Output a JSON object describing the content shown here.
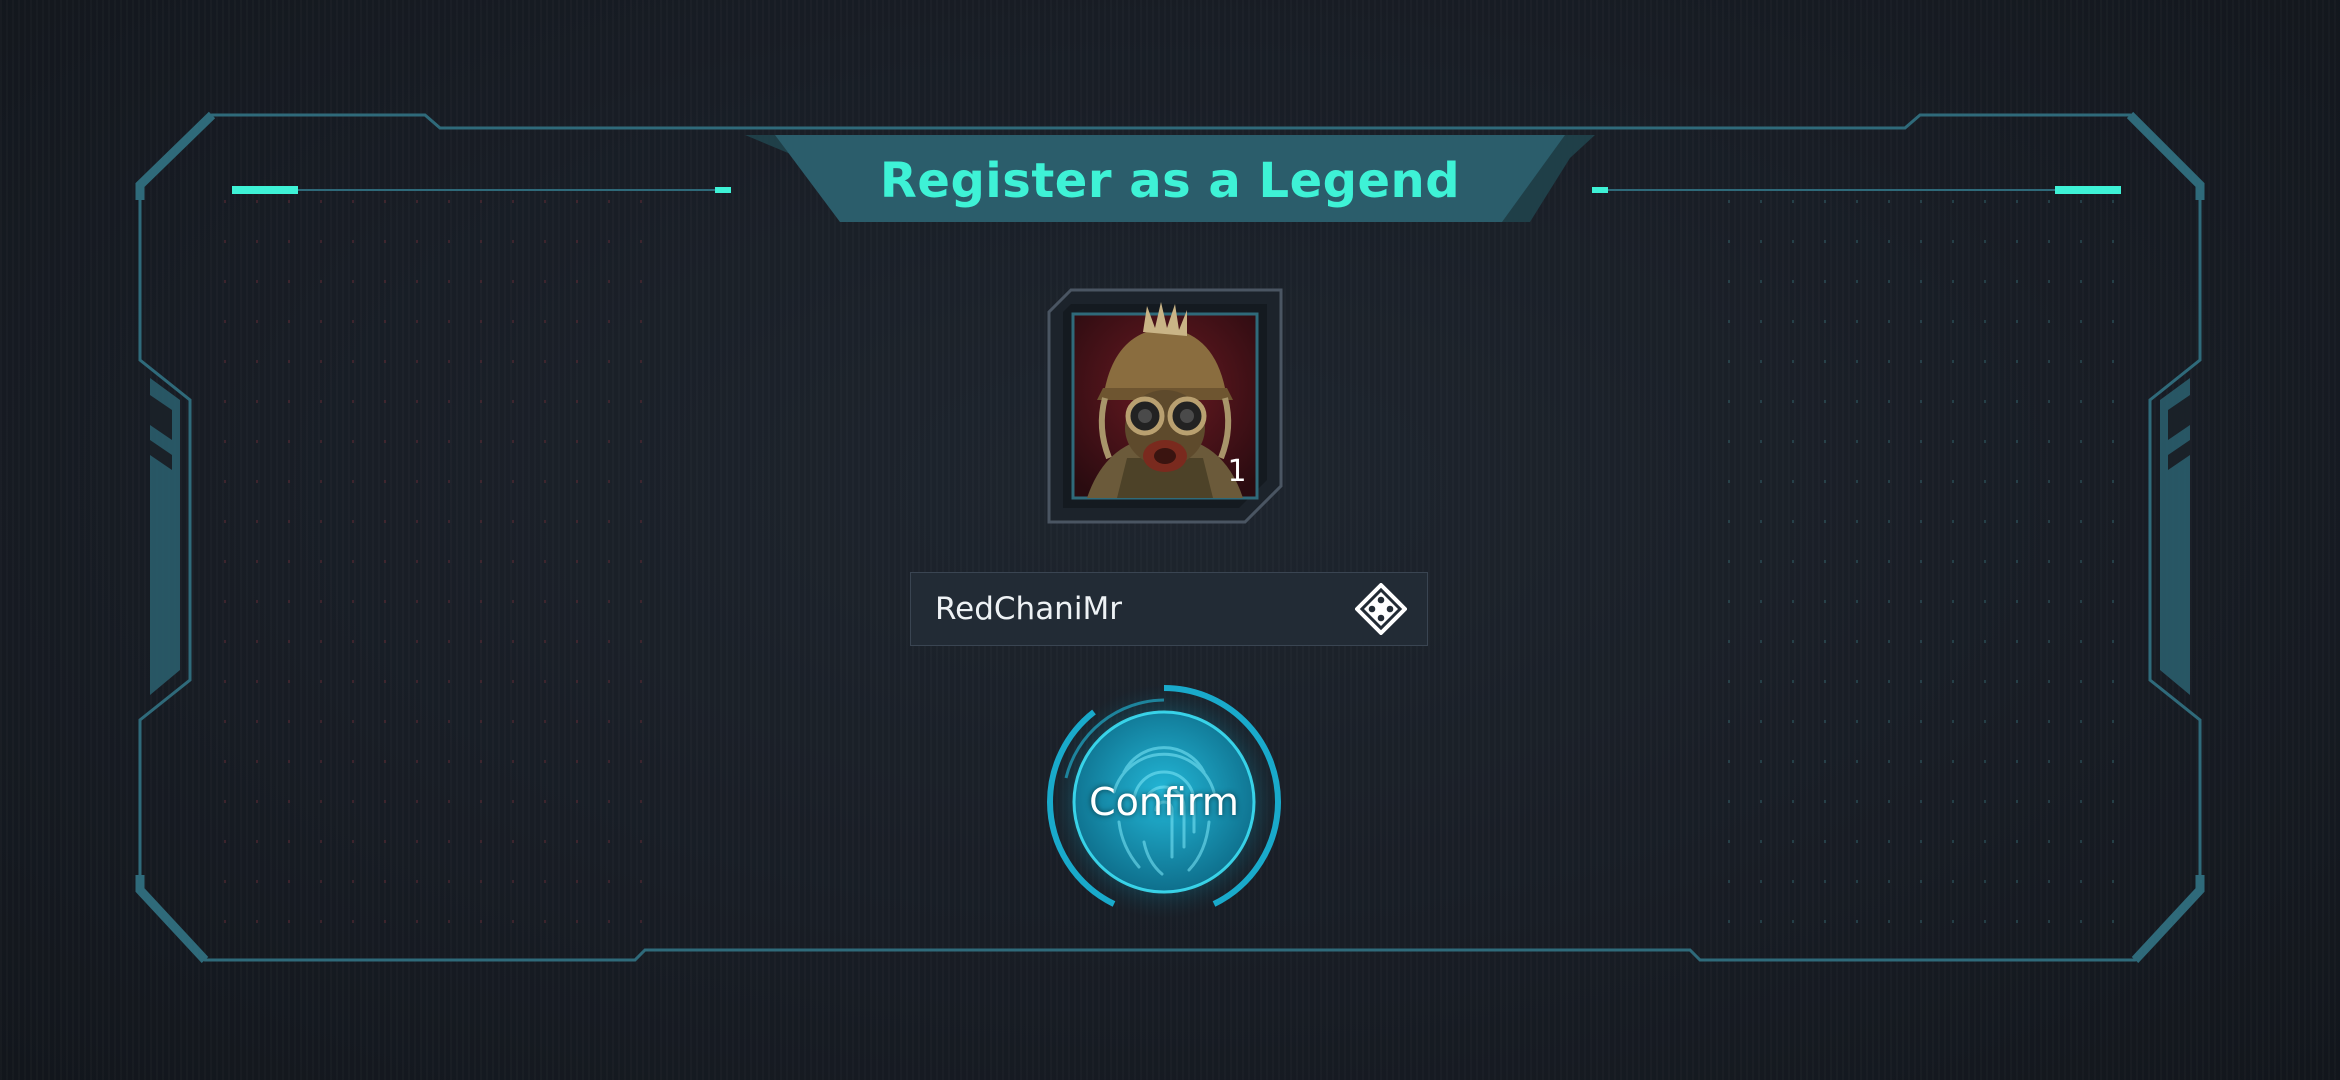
{
  "dialog": {
    "title": "Register as a Legend"
  },
  "avatar": {
    "character_icon": "legend-portrait-icon",
    "level_badge": "1"
  },
  "name_input": {
    "value": "RedChaniMr",
    "randomize_icon": "dice-icon"
  },
  "confirm_button": {
    "label": "Confirm",
    "icon": "fingerprint-icon"
  },
  "colors": {
    "accent": "#3ef2d6",
    "frame": "#2f6a7a",
    "title_bar": "#2a5c6a",
    "background": "#161b22",
    "button_glow": "#19b9dd"
  }
}
